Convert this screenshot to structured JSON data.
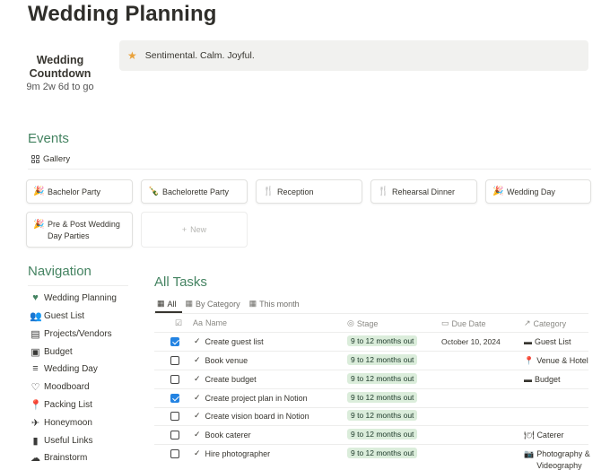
{
  "page": {
    "title": "Wedding Planning"
  },
  "countdown": {
    "title": "Wedding Countdown",
    "value": "9m 2w 6d to go"
  },
  "callout": {
    "icon": "star-icon",
    "text": "Sentimental. Calm. Joyful."
  },
  "events": {
    "heading": "Events",
    "view_label": "Gallery",
    "cards": [
      {
        "label": "Bachelor Party",
        "icon": "party-popper-icon"
      },
      {
        "label": "Bachelorette Party",
        "icon": "champagne-bottle-icon"
      },
      {
        "label": "Reception",
        "icon": "fork-knife-icon"
      },
      {
        "label": "Rehearsal Dinner",
        "icon": "fork-knife-icon"
      },
      {
        "label": "Wedding Day",
        "icon": "party-popper-icon"
      },
      {
        "label": "Pre & Post Wedding Day Parties",
        "icon": "party-popper-icon"
      }
    ],
    "new_label": "New"
  },
  "navigation": {
    "heading": "Navigation",
    "items": [
      {
        "label": "Wedding Planning",
        "icon": "heart-icon"
      },
      {
        "label": "Guest List",
        "icon": "people-icon"
      },
      {
        "label": "Projects/Vendors",
        "icon": "document-icon"
      },
      {
        "label": "Budget",
        "icon": "money-icon"
      },
      {
        "label": "Wedding Day",
        "icon": "stairs-icon"
      },
      {
        "label": "Moodboard",
        "icon": "heart-outline-icon"
      },
      {
        "label": "Packing List",
        "icon": "pin-icon"
      },
      {
        "label": "Honeymoon",
        "icon": "plane-icon"
      },
      {
        "label": "Useful Links",
        "icon": "book-icon"
      },
      {
        "label": "Brainstorm",
        "icon": "cloud-icon"
      }
    ]
  },
  "tasks": {
    "heading": "All Tasks",
    "tabs": [
      {
        "label": "All",
        "active": true
      },
      {
        "label": "By Category",
        "active": false
      },
      {
        "label": "This month",
        "active": false
      }
    ],
    "columns": {
      "name": "Name",
      "stage": "Stage",
      "due": "Due Date",
      "category": "Category"
    },
    "rows": [
      {
        "checked": true,
        "name": "Create guest list",
        "stage": "9 to 12 months out",
        "due": "October 10, 2024",
        "category": "Guest List",
        "category_icon": "card-icon"
      },
      {
        "checked": false,
        "name": "Book venue",
        "stage": "9 to 12 months out",
        "due": "",
        "category": "Venue & Hotel",
        "category_icon": "pin-icon"
      },
      {
        "checked": false,
        "name": "Create budget",
        "stage": "9 to 12 months out",
        "due": "",
        "category": "Budget",
        "category_icon": "card-icon"
      },
      {
        "checked": true,
        "name": "Create project plan in Notion",
        "stage": "9 to 12 months out",
        "due": "",
        "category": "",
        "category_icon": ""
      },
      {
        "checked": false,
        "name": "Create vision board in Notion",
        "stage": "9 to 12 months out",
        "due": "",
        "category": "",
        "category_icon": ""
      },
      {
        "checked": false,
        "name": "Book caterer",
        "stage": "9 to 12 months out",
        "due": "",
        "category": "Caterer",
        "category_icon": "plate-icon"
      },
      {
        "checked": false,
        "name": "Hire photographer",
        "stage": "9 to 12 months out",
        "due": "",
        "category": "Photography & Videography",
        "category_icon": "camera-icon"
      }
    ]
  },
  "colors": {
    "section_heading": "#448361",
    "stage_bg": "#dbeddb",
    "checkbox_checked": "#2383e2",
    "star": "#e9a23b"
  }
}
